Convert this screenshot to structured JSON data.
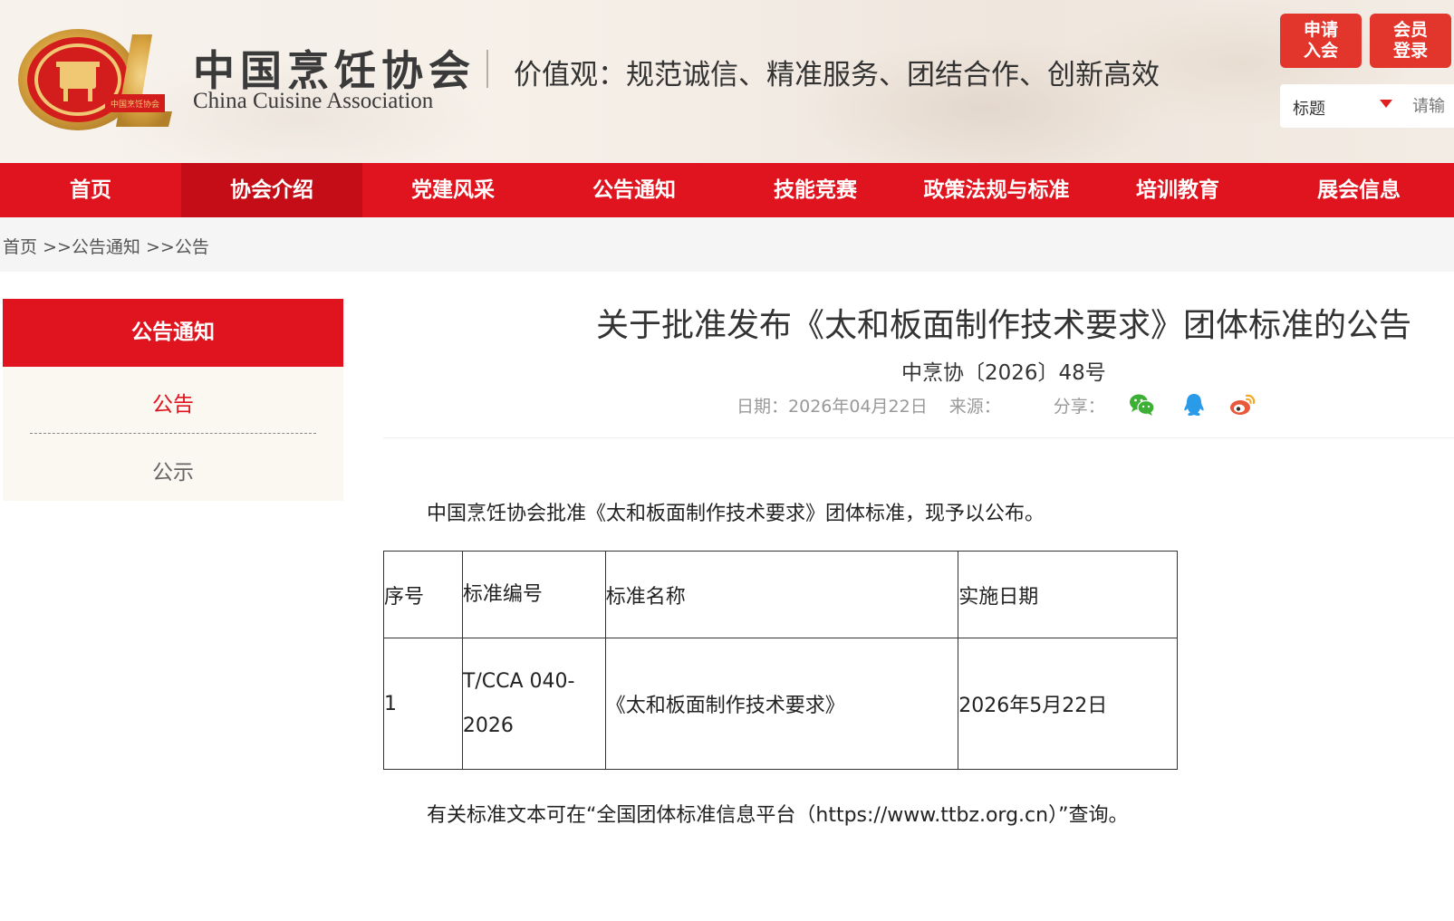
{
  "header": {
    "logo_name_cn": "中国烹饪协会",
    "logo_name_en": "China Cuisine Association",
    "emblem_text": "中国烹饪协会",
    "slogan": "价值观：规范诚信、精准服务、团结合作、创新高效",
    "apply_button": "申请\n入会",
    "apply_line1": "申请",
    "apply_line2": "入会",
    "login_line1": "会员",
    "login_line2": "登录",
    "search": {
      "select_value": "标题",
      "placeholder": "请输"
    }
  },
  "nav": {
    "items": [
      {
        "label": "首页"
      },
      {
        "label": "协会介绍"
      },
      {
        "label": "党建风采"
      },
      {
        "label": "公告通知"
      },
      {
        "label": "技能竞赛"
      },
      {
        "label": "政策法规与标准"
      },
      {
        "label": "培训教育"
      },
      {
        "label": "展会信息"
      }
    ],
    "active_index": 1,
    "color": "#e0141e",
    "active_color": "#c40d17"
  },
  "breadcrumb": {
    "home": "首页",
    "sep": ">>",
    "level1": "公告通知",
    "level2": "公告"
  },
  "sidebar": {
    "title": "公告通知",
    "items": [
      {
        "label": "公告",
        "active": true
      },
      {
        "label": "公示",
        "active": false
      }
    ]
  },
  "article": {
    "title": "关于批准发布《太和板面制作技术要求》团体标准的公告",
    "doc_number": "中烹协〔2026〕48号",
    "date_label": "日期：",
    "date_value": "2026年04月22日",
    "source_label": "来源：",
    "share_label": "分享：",
    "share_icons": [
      "wechat-icon",
      "qq-icon",
      "weibo-icon"
    ],
    "paragraph1": "中国烹饪协会批准《太和板面制作技术要求》团体标准，现予以公布。",
    "paragraph2": "有关标准文本可在“全国团体标准信息平台（https://www.ttbz.org.cn）”查询。",
    "table": {
      "headers": [
        "序号",
        "标准编号",
        "标准名称",
        "实施日期"
      ],
      "rows": [
        [
          "1",
          "T/CCA 040-2026",
          "《太和板面制作技术要求》",
          "2026年5月22日"
        ]
      ]
    }
  },
  "colors": {
    "brand_red": "#e0141e",
    "button_red": "#e2352b",
    "text": "#333333",
    "muted": "#999999"
  }
}
